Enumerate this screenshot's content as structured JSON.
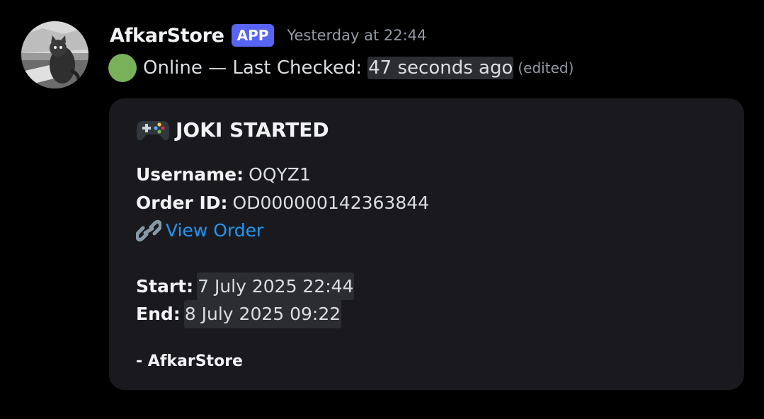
{
  "message": {
    "author": "AfkarStore",
    "badge": "APP",
    "timestamp": "Yesterday at 22:44",
    "status_prefix": "Online — Last Checked:",
    "status_time": "47 seconds ago",
    "edited": "(edited)"
  },
  "embed": {
    "title": "JOKI STARTED",
    "username_label": "Username:",
    "username_value": "OQYZ1",
    "order_label": "Order ID:",
    "order_value": "OD000000142363844",
    "link_text": "View Order",
    "start_label": "Start:",
    "start_value": "7 July 2025 22:44",
    "end_label": "End:",
    "end_value": "8 July 2025 09:22",
    "footer": "- AfkarStore"
  },
  "icons": {
    "status": "green-circle-icon",
    "title": "gamepad-icon",
    "link": "link-icon"
  },
  "colors": {
    "background": "#000000",
    "embed_bg": "#1a1a1e",
    "badge": "#5865f2",
    "link": "#2196f3",
    "status_green": "#78b159",
    "muted": "#949ba4"
  }
}
